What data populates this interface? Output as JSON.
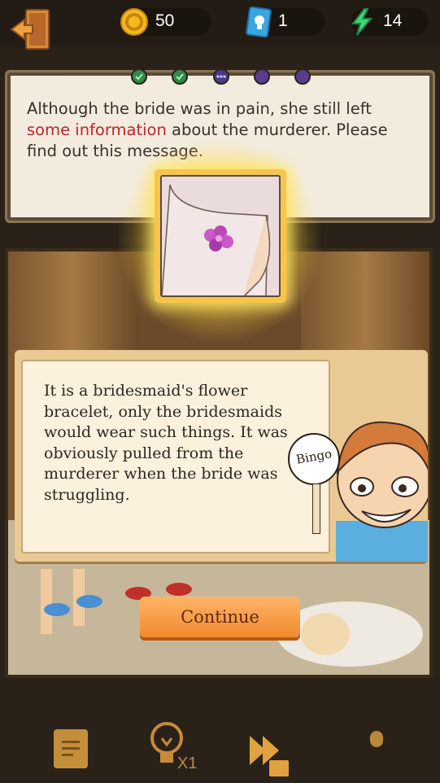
{
  "top_bar": {
    "coins": "50",
    "hints": "1",
    "energy": "14"
  },
  "task": {
    "text_before": "Although the bride was in pain, she still left ",
    "text_highlight": "some information",
    "text_after": " about the murderer. Please find out this message.",
    "highlight_color": "#c0252b"
  },
  "progress_dots": [
    {
      "state": "done"
    },
    {
      "state": "done"
    },
    {
      "state": "current"
    },
    {
      "state": "locked"
    },
    {
      "state": "locked"
    }
  ],
  "dialog": {
    "text": "It is a bridesmaid's flower bracelet, only the bridesmaids would wear such things. It was obviously pulled from the murderer when the bride was struggling.",
    "sign_label": "Bingo"
  },
  "continue_label": "Continue",
  "bottom_bar": {
    "hint_count": "X1"
  },
  "colors": {
    "accent": "#f18a2c",
    "dot_done": "#2f8a4a",
    "dot_current": "#4a3a8a",
    "dot_locked": "#5a3c8c"
  }
}
